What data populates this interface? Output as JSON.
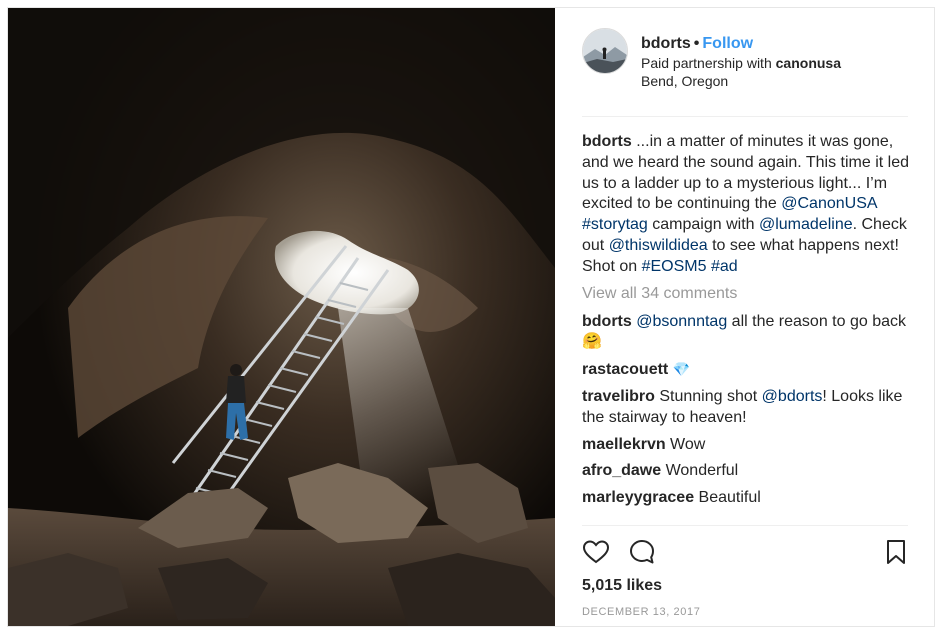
{
  "header": {
    "username": "bdorts",
    "separator": "•",
    "follow_label": "Follow",
    "partnership_prefix": "Paid partnership with",
    "partner": "canonusa",
    "location": "Bend, Oregon",
    "avatar_icon": "avatar-photo"
  },
  "caption": {
    "username": "bdorts",
    "segments": [
      " ...in a matter of minutes it was gone, and we heard the sound again. This time it led us to a ladder up to a mysterious light... I’m excited to be continuing the ",
      "@CanonUSA",
      " ",
      "#storytag",
      " campaign with ",
      "@lumadeline",
      ". Check out ",
      "@thiswildidea",
      " to see what happens next! Shot on ",
      "#EOSM5",
      " ",
      "#ad"
    ]
  },
  "view_all_comments": "View all 34 comments",
  "comments": [
    {
      "username": "bdorts",
      "mention": "@bsonnntag",
      "text": " all the reason to go back ",
      "emoji": "🤗"
    },
    {
      "username": "rastacouett",
      "text": "",
      "emoji": "💎"
    },
    {
      "username": "travelibro",
      "text_before": " Stunning shot ",
      "mention": "@bdorts",
      "text_after": "! Looks like the stairway to heaven!"
    },
    {
      "username": "maellekrvn",
      "text": " Wow"
    },
    {
      "username": "afro_dawe",
      "text": " Wonderful"
    },
    {
      "username": "marleyygracee",
      "text": " Beautiful"
    }
  ],
  "actions": {
    "like_icon": "heart-icon",
    "comment_icon": "comment-icon",
    "save_icon": "bookmark-icon"
  },
  "likes": "5,015 likes",
  "date": "DECEMBER 13, 2017",
  "colors": {
    "follow": "#3897f0",
    "link": "#003569",
    "muted": "#999999",
    "text": "#262626"
  }
}
